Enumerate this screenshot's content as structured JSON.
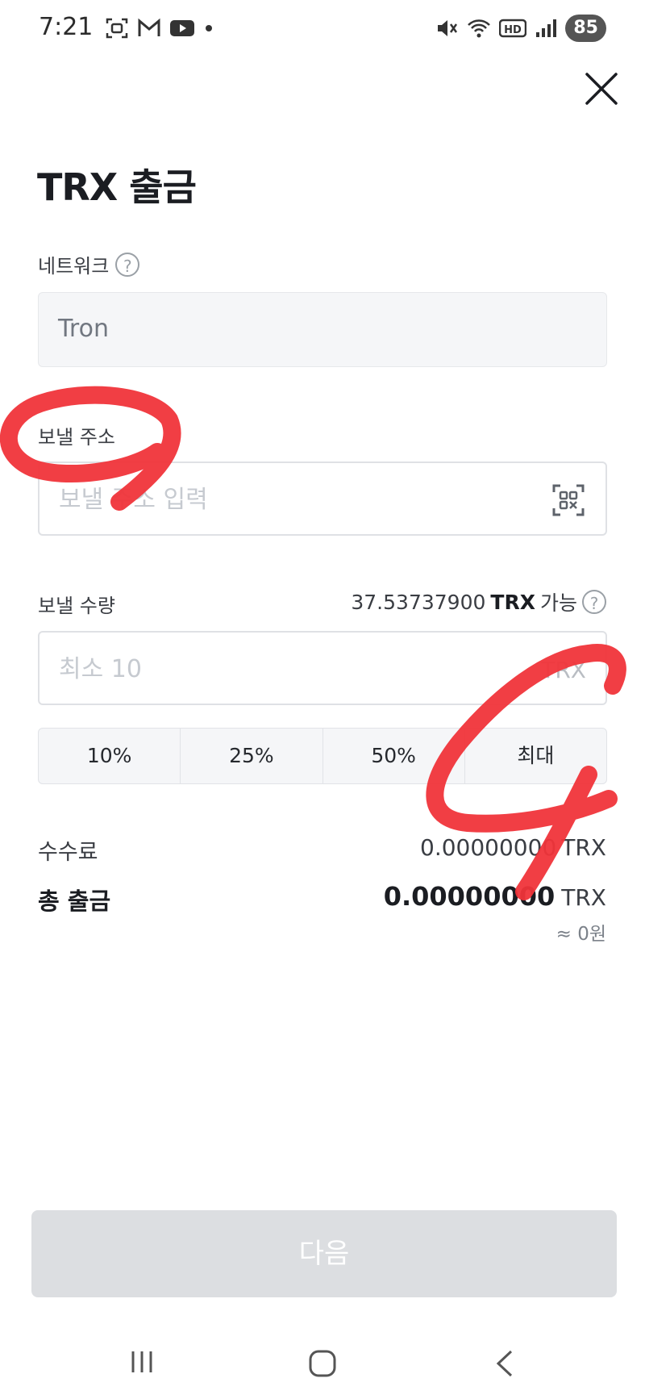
{
  "status_bar": {
    "time": "7:21",
    "battery": "85",
    "hd_label": "HD",
    "left_icons": [
      "screenshot-icon",
      "gmail-icon",
      "youtube-icon",
      "dot-icon"
    ],
    "right_icons": [
      "mute-icon",
      "wifi-icon",
      "hd-icon",
      "signal-icon",
      "battery-icon"
    ]
  },
  "header": {
    "title": "TRX 출금",
    "close_icon": "close-icon"
  },
  "network": {
    "label": "네트워크",
    "help_glyph": "?",
    "value": "Tron"
  },
  "address": {
    "label": "보낼 주소",
    "placeholder": "보낼 주소 입력",
    "qr_icon": "qr-scan-icon"
  },
  "amount": {
    "label": "보낼 수량",
    "available_amount": "37.53737900",
    "available_unit": "TRX",
    "available_suffix": "가능",
    "help_glyph": "?",
    "placeholder": "최소 10",
    "unit": "TRX"
  },
  "percent_buttons": [
    "10%",
    "25%",
    "50%",
    "최대"
  ],
  "fee": {
    "label": "수수료",
    "value": "0.00000000",
    "unit": "TRX"
  },
  "total": {
    "label": "총 출금",
    "value": "0.00000000",
    "unit": "TRX",
    "krw_estimate": "≈ 0원"
  },
  "next_button": {
    "label": "다음",
    "enabled": false
  },
  "nav_bar": {
    "icons": [
      "recent-apps-icon",
      "home-icon",
      "back-icon"
    ]
  },
  "colors": {
    "annotation_red": "#f0343a",
    "disabled_button": "#dcdee1",
    "field_background": "#f5f6f8"
  }
}
